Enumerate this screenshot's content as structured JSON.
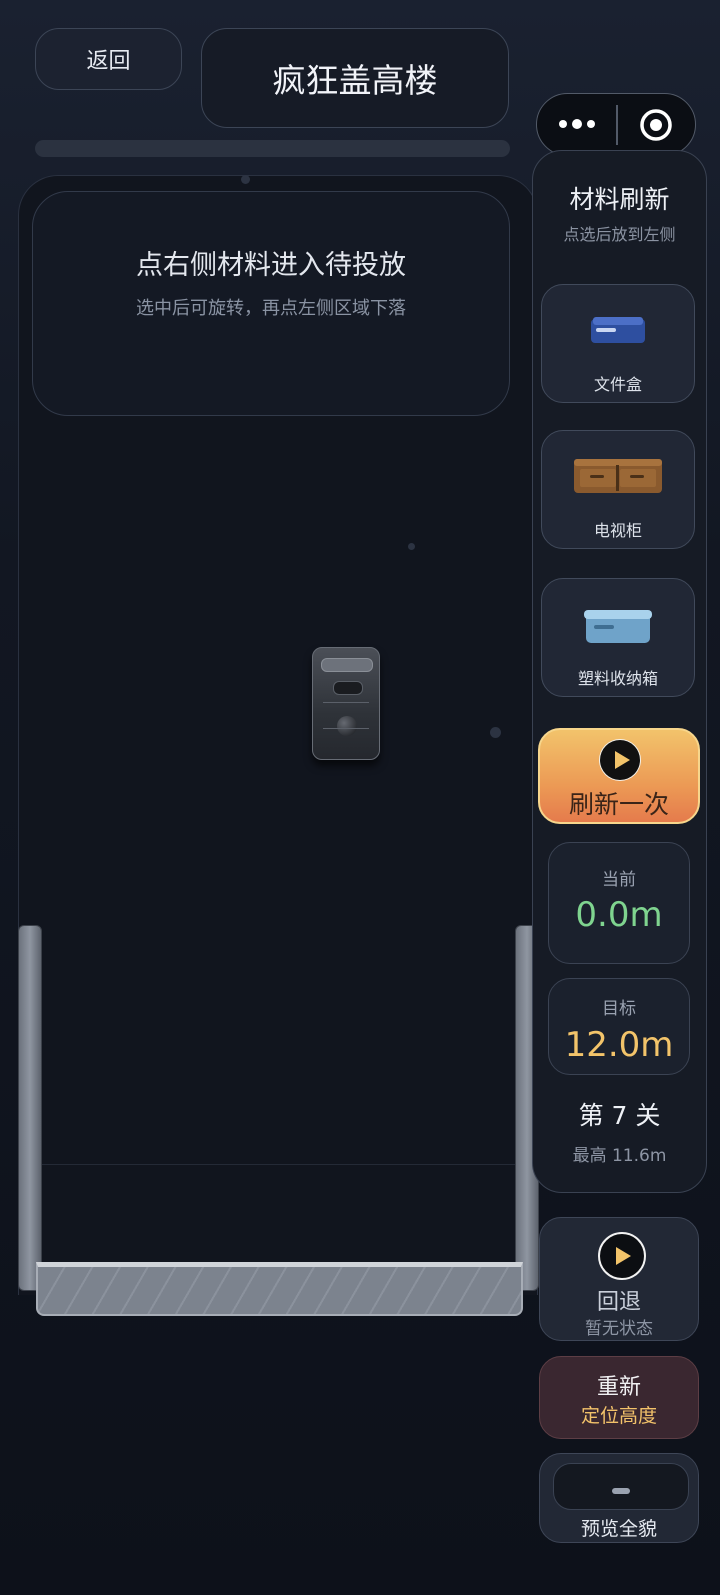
{
  "header": {
    "back_label": "返回",
    "title": "疯狂盖高楼"
  },
  "hint": {
    "title": "点右侧材料进入待投放",
    "subtitle": "选中后可旋转，再点左侧区域下落"
  },
  "panel": {
    "title": "材料刷新",
    "subtitle": "点选后放到左侧",
    "materials": [
      {
        "label": "文件盒",
        "icon": "file-box-icon"
      },
      {
        "label": "电视柜",
        "icon": "tv-cabinet-icon"
      },
      {
        "label": "塑料收纳箱",
        "icon": "plastic-storage-box-icon"
      }
    ],
    "refresh_label": "刷新一次",
    "current": {
      "label": "当前",
      "value": "0.0m"
    },
    "target": {
      "label": "目标",
      "value": "12.0m"
    },
    "level": "第 7 关",
    "best": "最高 11.6m"
  },
  "actions": {
    "undo_label": "回退",
    "undo_status": "暂无状态",
    "reset_line1": "重新",
    "reset_line2": "定位高度",
    "preview_label": "预览全貌"
  },
  "colors": {
    "current_value": "#7fd48f",
    "target_value": "#f3c46a",
    "refresh_button": "#ec9a55"
  }
}
